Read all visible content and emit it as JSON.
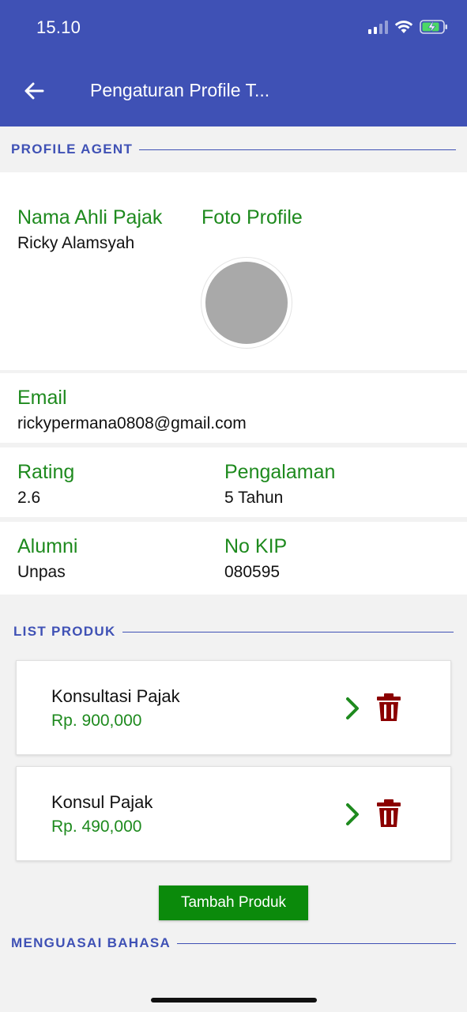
{
  "status_bar": {
    "time": "15.10",
    "signal_icon": "cellular-signal-icon",
    "wifi_icon": "wifi-icon",
    "battery_icon": "battery-charging-icon"
  },
  "appbar": {
    "title": "Pengaturan Profile T...",
    "back_icon": "arrow-left-icon"
  },
  "sections": {
    "profile": "PROFILE AGENT",
    "products": "LIST PRODUK",
    "languages": "MENGUASAI BAHASA"
  },
  "profile": {
    "name_label": "Nama Ahli Pajak",
    "name_value": "Ricky Alamsyah",
    "photo_label": "Foto Profile",
    "email_label": "Email",
    "email_value": "rickypermana0808@gmail.com",
    "rating_label": "Rating",
    "rating_value": "2.6",
    "experience_label": "Pengalaman",
    "experience_value": "5 Tahun",
    "alumni_label": "Alumni",
    "alumni_value": "Unpas",
    "kip_label": "No KIP",
    "kip_value": "080595"
  },
  "products": [
    {
      "name": "Konsultasi Pajak",
      "price": "Rp. 900,000"
    },
    {
      "name": "Konsul Pajak",
      "price": "Rp. 490,000"
    }
  ],
  "add_product_label": "Tambah Produk",
  "colors": {
    "primary": "#3f51b5",
    "label_green": "#1e8a1e",
    "button_green": "#0b8a0b",
    "delete_red": "#8b0000",
    "avatar_gray": "#a9a9a9"
  }
}
